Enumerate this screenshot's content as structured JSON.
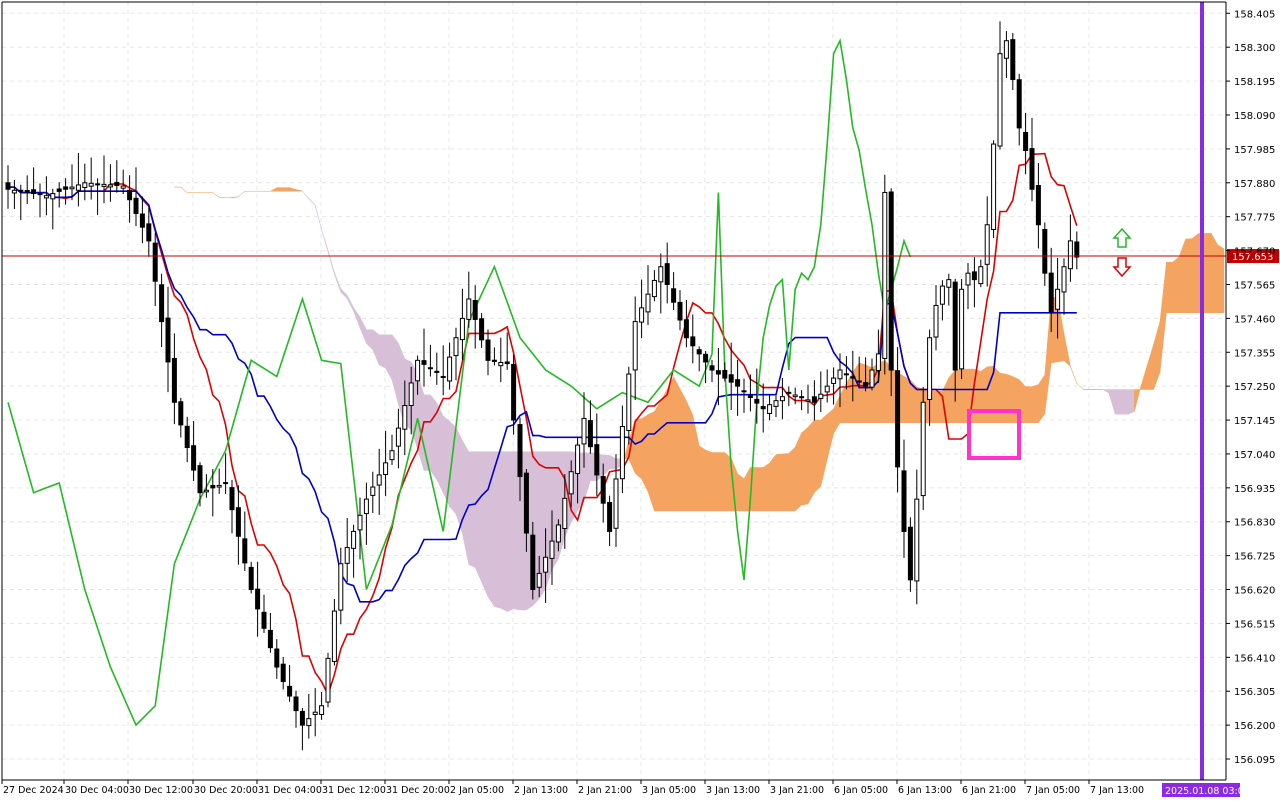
{
  "chart_data": {
    "type": "candlestick",
    "instrument_view": "price chart with Ichimoku Kinko Hyo",
    "current_price_label": "157.653",
    "current_price": 157.653,
    "y_axis_ticks": [
      "158.405",
      "158.300",
      "158.195",
      "158.090",
      "157.985",
      "157.880",
      "157.775",
      "157.670",
      "157.565",
      "157.460",
      "157.355",
      "157.250",
      "157.145",
      "157.040",
      "156.935",
      "156.830",
      "156.725",
      "156.620",
      "156.515",
      "156.410",
      "156.305",
      "156.200",
      "156.095"
    ],
    "x_axis_ticks": [
      "27 Dec 2024",
      "30 Dec 04:00",
      "30 Dec 12:00",
      "30 Dec 20:00",
      "31 Dec 04:00",
      "31 Dec 12:00",
      "31 Dec 20:00",
      "2 Jan 05:00",
      "2 Jan 13:00",
      "2 Jan 21:00",
      "3 Jan 05:00",
      "3 Jan 13:00",
      "3 Jan 21:00",
      "6 Jan 05:00",
      "6 Jan 13:00",
      "6 Jan 21:00",
      "7 Jan 05:00",
      "7 Jan 13:00"
    ],
    "future_time_label": "2025.01.08 03:00",
    "ylim": [
      156.03,
      158.44
    ],
    "grid": true,
    "colors": {
      "bull_candle": "#000000",
      "bear_candle": "#000000",
      "tenkan": "#e00000",
      "kijun": "#0000cc",
      "chikou": "#22bb22",
      "kumo_bullish": "#f4a460",
      "kumo_bearish": "#d8bfd8",
      "price_line": "#c00000",
      "vertical_marker": "#8a2be2",
      "highlight_box": "#ff33cc",
      "arrow_up": "#22bb22",
      "arrow_down": "#e00000"
    },
    "annotations": [
      "arrow-up",
      "arrow-down",
      "highlight-box",
      "vertical-time-marker"
    ]
  }
}
